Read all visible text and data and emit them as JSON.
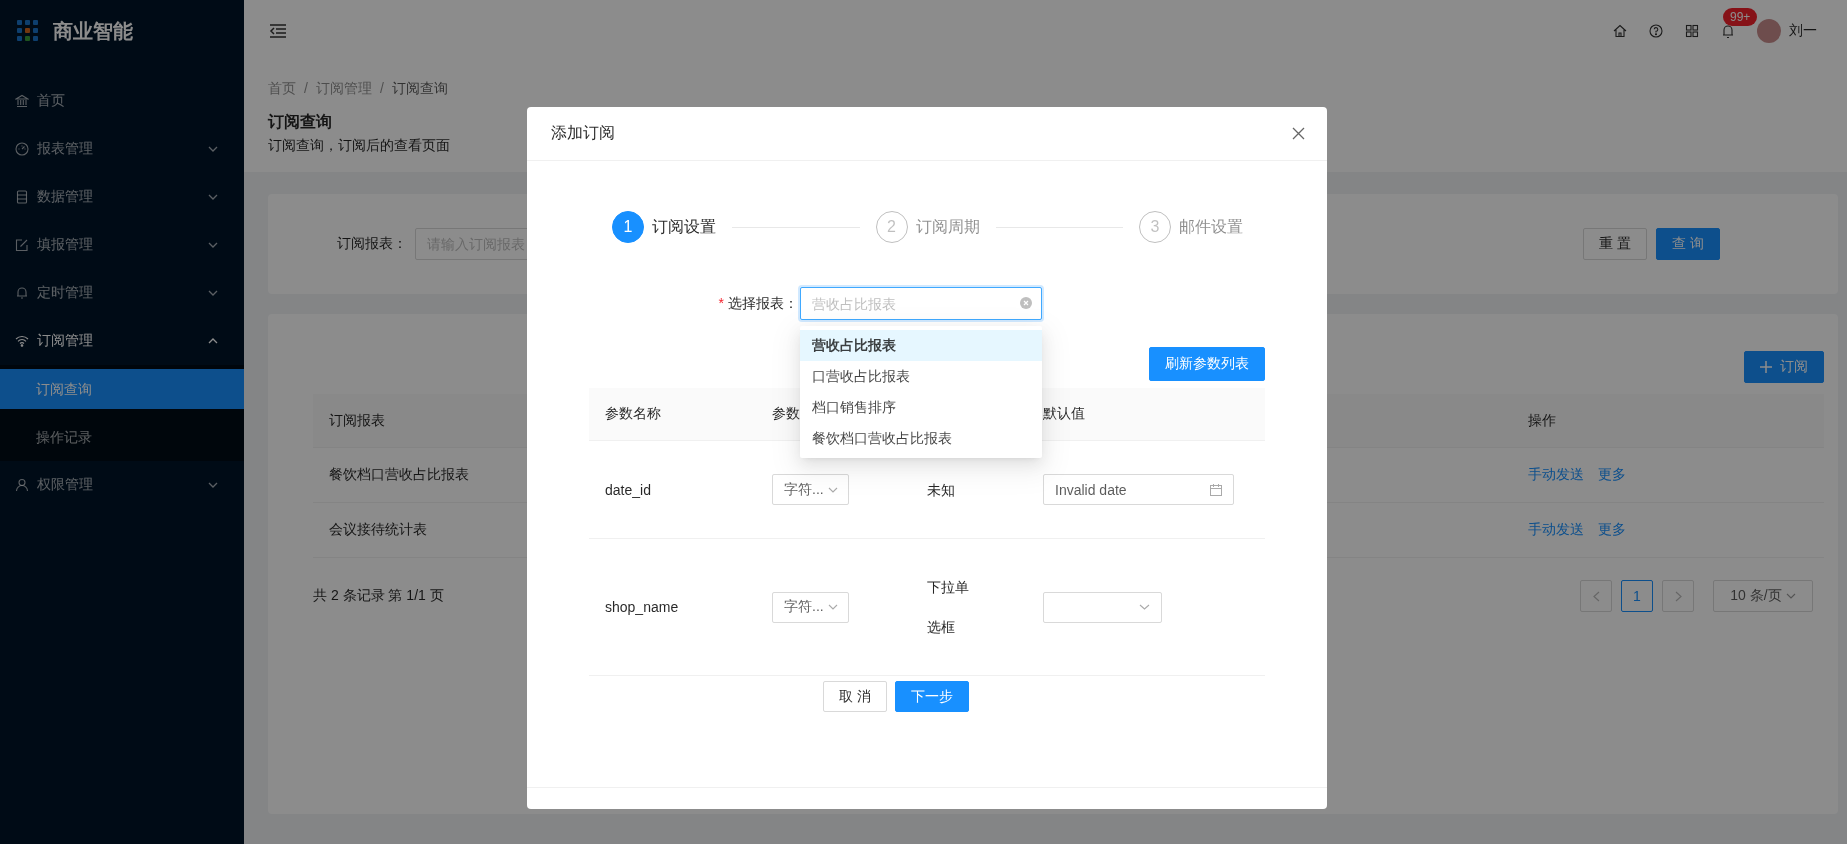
{
  "sidebar": {
    "brand": "商业智能",
    "items": [
      {
        "kind": "link",
        "label": "首页",
        "selected": false
      },
      {
        "kind": "group",
        "label": "报表管理",
        "expanded": false
      },
      {
        "kind": "group",
        "label": "数据管理",
        "expanded": false
      },
      {
        "kind": "group",
        "label": "填报管理",
        "expanded": false
      },
      {
        "kind": "group",
        "label": "定时管理",
        "expanded": false
      },
      {
        "kind": "group",
        "label": "订阅管理",
        "expanded": true,
        "children": [
          {
            "label": "订阅查询",
            "selected": true
          },
          {
            "label": "操作记录",
            "selected": false
          }
        ]
      },
      {
        "kind": "group",
        "label": "权限管理",
        "expanded": false
      }
    ]
  },
  "header": {
    "notification_badge": "99+",
    "user_name": "刘一"
  },
  "page": {
    "breadcrumb": [
      "首页",
      "订阅管理",
      "订阅查询"
    ],
    "breadcrumb_separators": [
      "/",
      "/"
    ],
    "title": "订阅查询",
    "description": "订阅查询，订阅后的查看页面",
    "search": {
      "label": "订阅报表：",
      "placeholder": "请输入订阅报表",
      "reset_button": "重 置",
      "query_button": "查 询"
    },
    "table": {
      "add_button": "订阅",
      "columns": [
        "订阅报表",
        "操作"
      ],
      "rows": [
        {
          "report": "餐饮档口营收占比报表",
          "actions": [
            "手动发送",
            "更多"
          ]
        },
        {
          "report": "会议接待统计表",
          "actions": [
            "手动发送",
            "更多"
          ]
        }
      ]
    },
    "pagination": {
      "summary": "共 2 条记录 第 1/1 页",
      "pages": [
        {
          "label": "1",
          "selected": true
        }
      ],
      "page_size": "10 条/页"
    }
  },
  "dialog": {
    "title": "添加订阅",
    "steps": [
      {
        "number": "1",
        "label": "订阅设置",
        "selected": true
      },
      {
        "number": "2",
        "label": "订阅周期",
        "selected": false
      },
      {
        "number": "3",
        "label": "邮件设置",
        "selected": false
      }
    ],
    "form": {
      "required_mark": "*",
      "label": "选择报表：",
      "placeholder": "营收占比报表"
    },
    "dropdown": [
      {
        "label": "营收占比报表",
        "selected": true
      },
      {
        "label": "口营收占比报表",
        "selected": false
      },
      {
        "label": "档口销售排序",
        "selected": false
      },
      {
        "label": "餐饮档口营收占比报表",
        "selected": false
      }
    ],
    "refresh_button": "刷新参数列表",
    "params": {
      "columns": [
        "参数名称",
        "参数",
        "默认值"
      ],
      "rows": [
        {
          "name": "date_id",
          "type": "字符...",
          "type_label": "未知",
          "default": {
            "kind": "date",
            "value": "Invalid date"
          }
        },
        {
          "name": "shop_name",
          "type": "字符...",
          "type_label": "下拉单选框",
          "default": {
            "kind": "select"
          }
        }
      ]
    },
    "cancel_button": "取 消",
    "next_button": "下一步"
  }
}
